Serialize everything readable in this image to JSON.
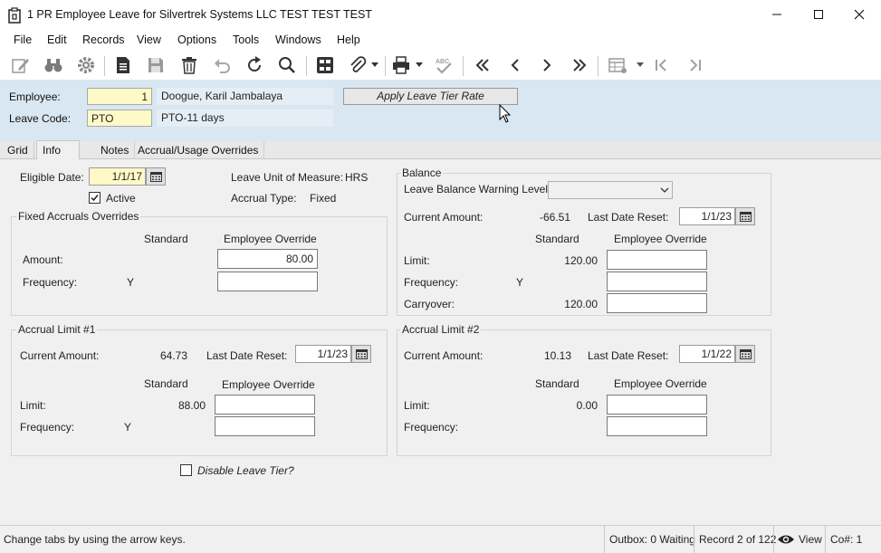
{
  "window": {
    "title": "1 PR Employee Leave for Silvertrek Systems LLC TEST TEST TEST"
  },
  "menu": [
    "File",
    "Edit",
    "Records",
    "View",
    "Options",
    "Tools",
    "Windows",
    "Help"
  ],
  "toolbar_icons": [
    "edit-icon",
    "binoculars-icon",
    "gear-icon",
    "new-document-icon",
    "save-icon",
    "delete-icon",
    "undo-icon",
    "refresh-icon",
    "search-icon",
    "form-grid-icon",
    "attachment-icon",
    "print-icon",
    "spellcheck-icon",
    "first-record-icon",
    "previous-record-icon",
    "next-record-icon",
    "last-record-icon",
    "grid-view-icon",
    "go-first-icon",
    "go-last-icon"
  ],
  "header": {
    "employee_label": "Employee:",
    "employee_id": "1",
    "employee_name": "Doogue, Karil Jambalaya",
    "leave_code_label": "Leave Code:",
    "leave_code": "PTO",
    "leave_code_desc": "PTO-11 days",
    "apply_button": "Apply Leave Tier Rate"
  },
  "tabs": [
    "Grid",
    "Info",
    "Notes",
    "Accrual/Usage Overrides"
  ],
  "info": {
    "eligible_date_label": "Eligible Date:",
    "eligible_date": "1/1/17",
    "active_label": "Active",
    "active_checked": true,
    "unit_label": "Leave Unit of Measure:",
    "unit_value": "HRS",
    "accrual_type_label": "Accrual Type:",
    "accrual_type_value": "Fixed"
  },
  "fixed_accruals": {
    "title": "Fixed Accruals Overrides",
    "standard_header": "Standard",
    "override_header": "Employee Override",
    "amount_label": "Amount:",
    "amount_standard": "",
    "amount_override": "80.00",
    "frequency_label": "Frequency:",
    "frequency_standard": "Y",
    "frequency_override": ""
  },
  "balance": {
    "title": "Balance",
    "warning_label": "Leave Balance Warning Level:",
    "warning_value": "",
    "current_label": "Current Amount:",
    "current_value": "-66.51",
    "reset_label": "Last Date Reset:",
    "reset_value": "1/1/23",
    "standard_header": "Standard",
    "override_header": "Employee Override",
    "limit_label": "Limit:",
    "limit_standard": "120.00",
    "limit_override": "",
    "frequency_label": "Frequency:",
    "frequency_standard": "Y",
    "frequency_override": "",
    "carryover_label": "Carryover:",
    "carryover_standard": "120.00",
    "carryover_override": ""
  },
  "accrual_limit_1": {
    "title": "Accrual Limit #1",
    "current_label": "Current Amount:",
    "current_value": "64.73",
    "reset_label": "Last Date Reset:",
    "reset_value": "1/1/23",
    "standard_header": "Standard",
    "override_header": "Employee Override",
    "limit_label": "Limit:",
    "limit_standard": "88.00",
    "limit_override": "",
    "frequency_label": "Frequency:",
    "frequency_standard": "Y",
    "frequency_override": ""
  },
  "accrual_limit_2": {
    "title": "Accrual Limit #2",
    "current_label": "Current Amount:",
    "current_value": "10.13",
    "reset_label": "Last Date Reset:",
    "reset_value": "1/1/22",
    "standard_header": "Standard",
    "override_header": "Employee Override",
    "limit_label": "Limit:",
    "limit_standard": "0.00",
    "limit_override": "",
    "frequency_label": "Frequency:",
    "frequency_standard": "",
    "frequency_override": ""
  },
  "disable_tier": {
    "label": "Disable Leave Tier?",
    "checked": false
  },
  "statusbar": {
    "hint": "Change tabs by using the arrow keys.",
    "outbox": "Outbox: 0 Waiting",
    "record": "Record 2 of 122",
    "view": "View",
    "company": "Co#: 1"
  }
}
